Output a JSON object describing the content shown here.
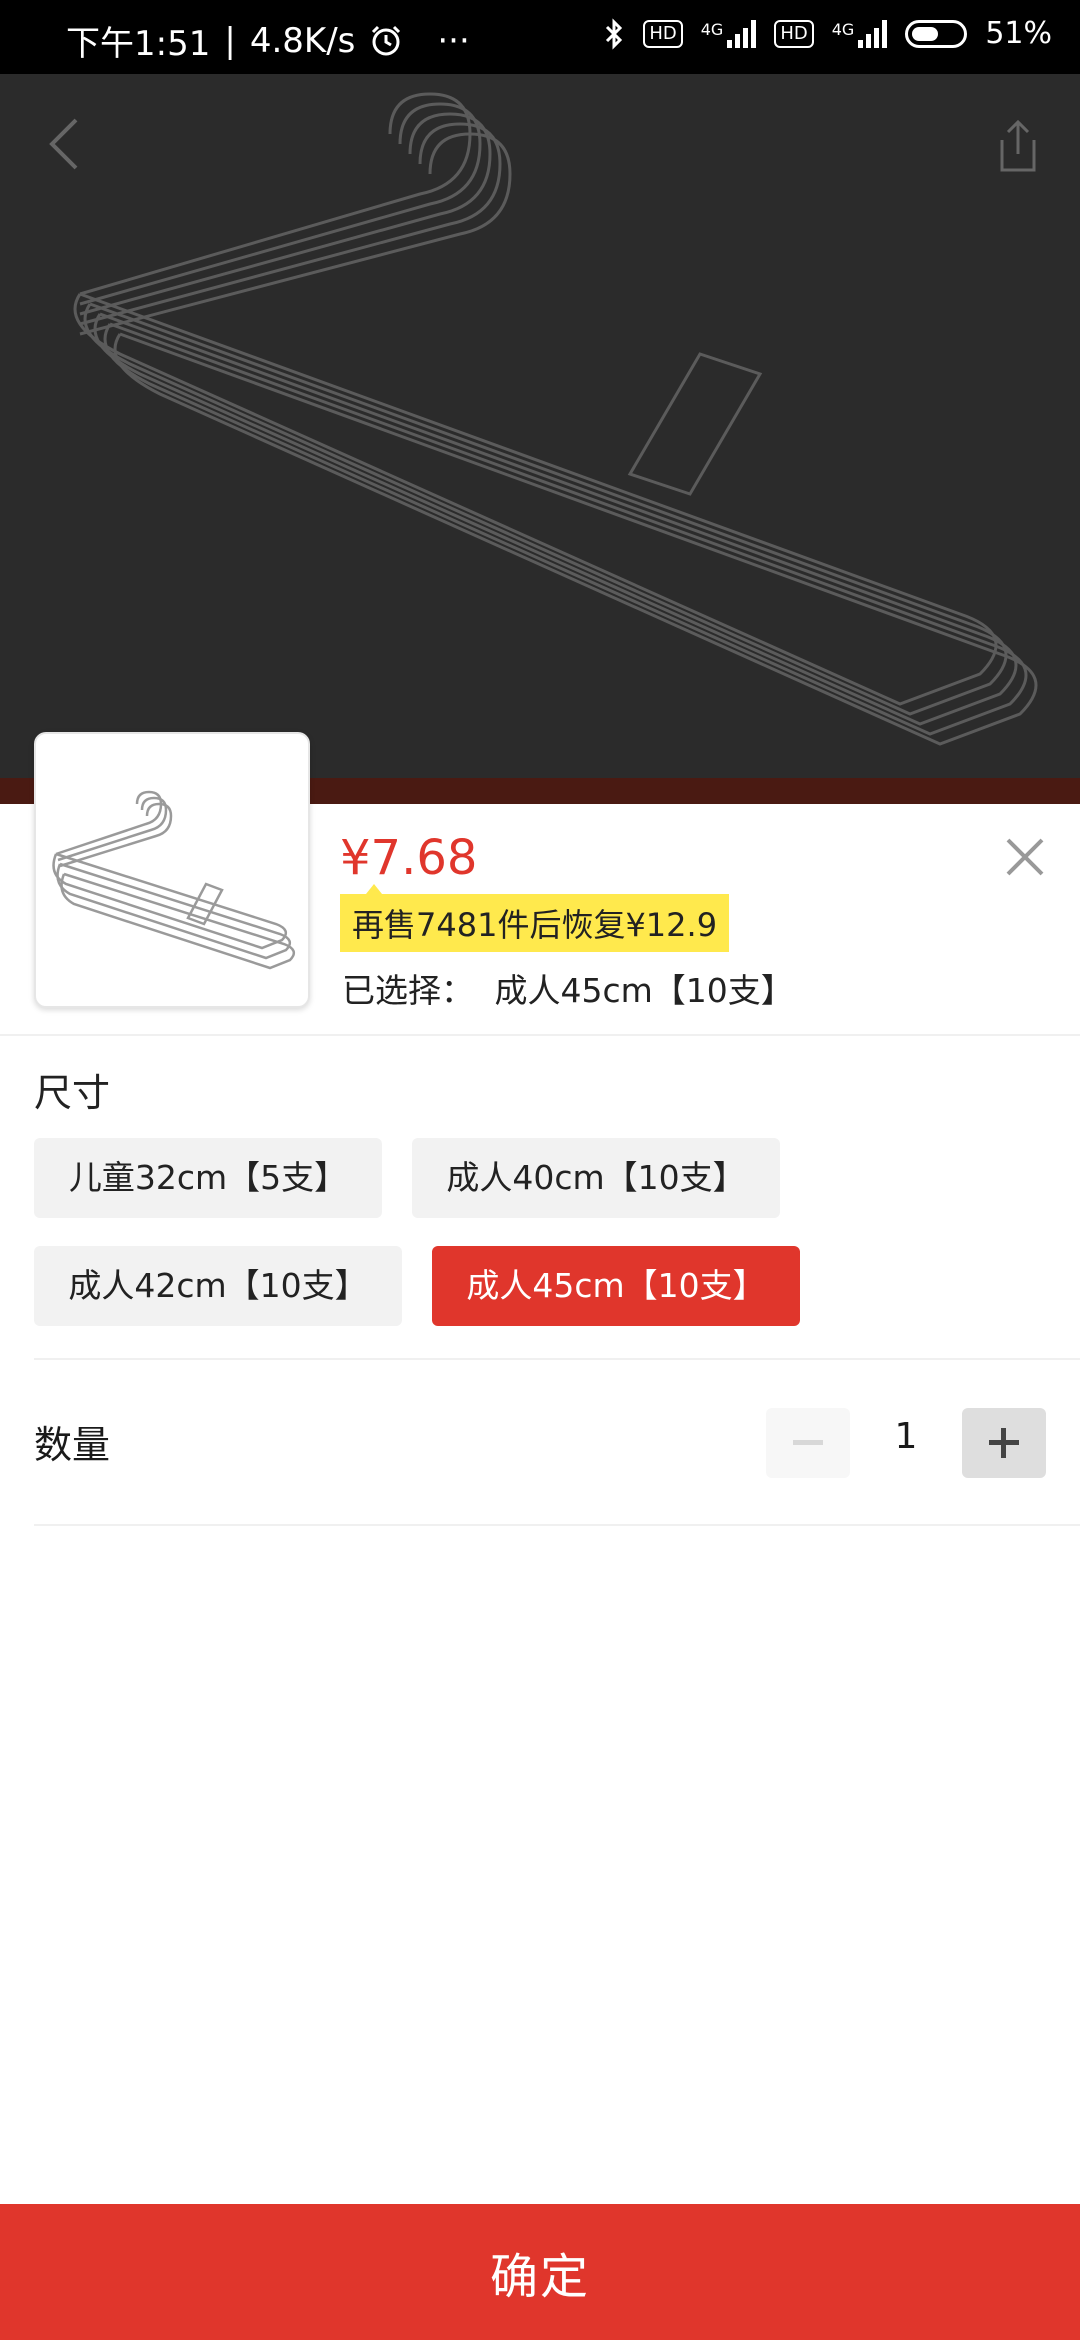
{
  "status_bar": {
    "time": "下午1:51",
    "speed": "4.8K/s",
    "more": "···",
    "hd1": "HD",
    "net1": "4G",
    "hd2": "HD",
    "net2": "4G",
    "battery": "51%"
  },
  "product": {
    "price": "¥7.68",
    "promo": "再售7481件后恢复¥12.9",
    "selected_label": "已选择：",
    "selected_value": "成人45cm【10支】"
  },
  "size": {
    "title": "尺寸",
    "options": [
      "儿童32cm【5支】",
      "成人40cm【10支】",
      "成人42cm【10支】",
      "成人45cm【10支】"
    ],
    "selected_index": 3
  },
  "quantity": {
    "label": "数量",
    "value": "1"
  },
  "confirm_label": "确定",
  "colors": {
    "accent": "#e0362c",
    "promo_bg": "#ffe94d"
  }
}
